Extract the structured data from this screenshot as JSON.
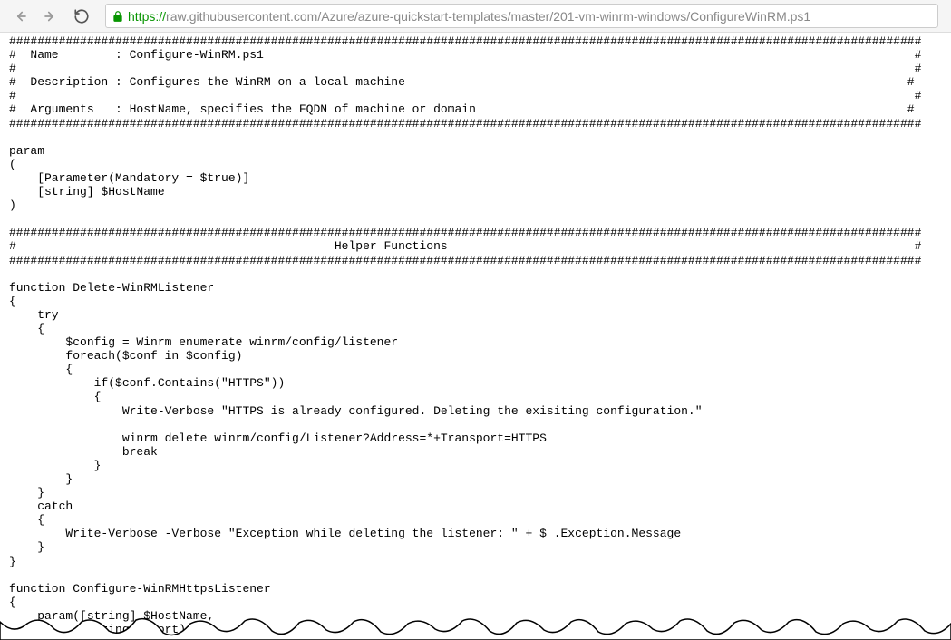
{
  "browser": {
    "url": {
      "scheme": "https://",
      "host": "raw.githubusercontent.com",
      "path": "/Azure/azure-quickstart-templates/master/201-vm-winrm-windows/ConfigureWinRM.ps1"
    }
  },
  "code": "#################################################################################################################################\n#  Name        : Configure-WinRM.ps1                                                                                            #\n#                                                                                                                               #\n#  Description : Configures the WinRM on a local machine                                                                       #\n#                                                                                                                               #\n#  Arguments   : HostName, specifies the FQDN of machine or domain                                                             #\n#################################################################################################################################\n\nparam\n(\n    [Parameter(Mandatory = $true)]\n    [string] $HostName\n)\n\n#################################################################################################################################\n#                                             Helper Functions                                                                  #\n#################################################################################################################################\n\nfunction Delete-WinRMListener\n{\n    try\n    {\n        $config = Winrm enumerate winrm/config/listener\n        foreach($conf in $config)\n        {\n            if($conf.Contains(\"HTTPS\"))\n            {\n                Write-Verbose \"HTTPS is already configured. Deleting the exisiting configuration.\"\n\n                winrm delete winrm/config/Listener?Address=*+Transport=HTTPS\n                break\n            }\n        }\n    }\n    catch\n    {\n        Write-Verbose -Verbose \"Exception while deleting the listener: \" + $_.Exception.Message\n    }\n}\n\nfunction Configure-WinRMHttpsListener\n{\n    param([string] $HostName,\n          [string] $port)"
}
